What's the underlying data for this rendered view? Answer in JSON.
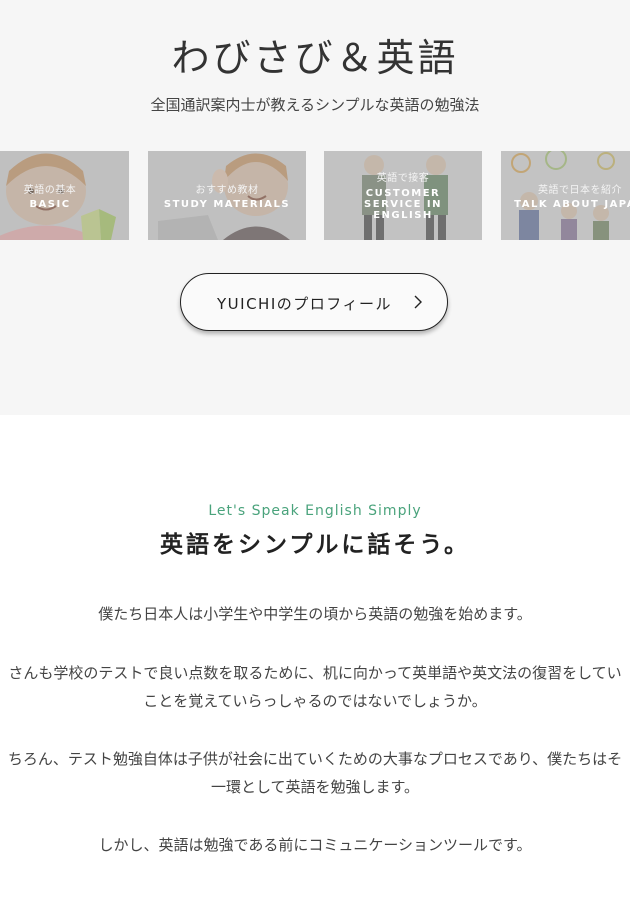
{
  "hero": {
    "title": "わびさび＆英語",
    "tagline": "全国通訳案内士が教えるシンプルな英語の勉強法"
  },
  "cards": [
    {
      "jp": "英語の基本",
      "en": "BASIC"
    },
    {
      "jp": "おすすめ教材",
      "en": "STUDY MATERIALS"
    },
    {
      "jp": "英語で接客",
      "en": "CUSTOMER\nSERVICE IN\nENGLISH"
    },
    {
      "jp": "英語で日本を紹介",
      "en": "TALK ABOUT JAPAN"
    }
  ],
  "profile_button": {
    "label": "YUICHIのプロフィール",
    "icon": "chevron-right-icon"
  },
  "intro": {
    "eyebrow": "Let's Speak English Simply",
    "title": "英語をシンプルに話そう。",
    "paragraphs": [
      [
        "僕たち日本人は小学生や中学生の頃から英語の勉強を始めます。"
      ],
      [
        "さんも学校のテストで良い点数を取るために、机に向かって英単語や英文法の復習をしてい",
        "ことを覚えていらっしゃるのではないでしょうか。"
      ],
      [
        "ちろん、テスト勉強自体は子供が社会に出ていくための大事なプロセスであり、僕たちはそ",
        "一環として英語を勉強します。"
      ],
      [
        "しかし、英語は勉強である前にコミュニケーションツールです。"
      ]
    ]
  },
  "colors": {
    "accent": "#4aa37c",
    "hero_bg": "#f6f6f6"
  }
}
